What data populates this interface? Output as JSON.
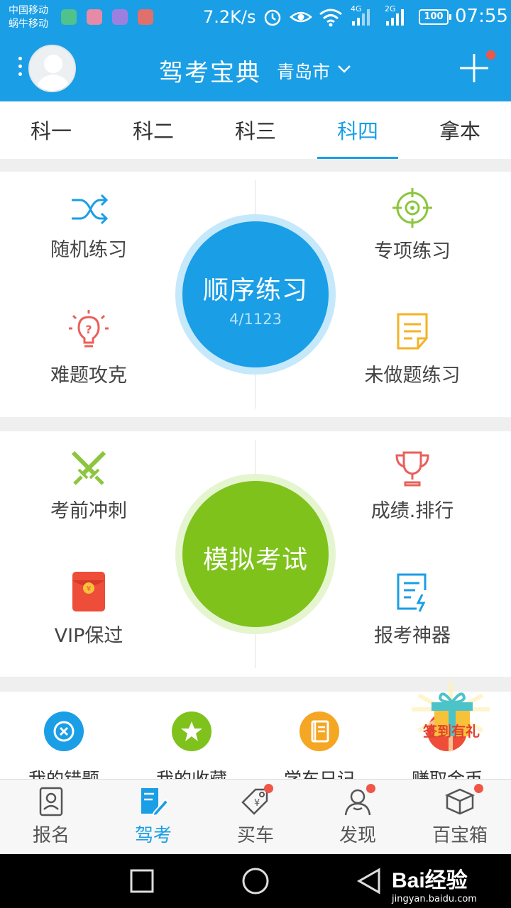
{
  "status_bar": {
    "carrier_1": "中国移动",
    "carrier_2": "蜗牛移动",
    "net_speed": "7.2K/s",
    "net_1": "4G",
    "net_2": "2G",
    "battery": "100",
    "time": "07:55"
  },
  "header": {
    "title": "驾考宝典",
    "city": "青岛市"
  },
  "tabs": [
    {
      "label": "科一"
    },
    {
      "label": "科二"
    },
    {
      "label": "科三"
    },
    {
      "label": "科四",
      "active": true
    },
    {
      "label": "拿本"
    }
  ],
  "practice_panel": {
    "random_label": "随机练习",
    "special_label": "专项练习",
    "hard_label": "难题攻克",
    "undone_label": "未做题练习",
    "center_title": "顺序练习",
    "center_progress": "4/1123"
  },
  "exam_panel": {
    "sprint_label": "考前冲刺",
    "ranking_label": "成绩.排行",
    "vip_label": "VIP保过",
    "tool_label": "报考神器",
    "center_title": "模拟考试"
  },
  "quick_panel": {
    "items": [
      {
        "label": "我的错题"
      },
      {
        "label": "我的收藏"
      },
      {
        "label": "学车日记"
      },
      {
        "label": "赚取金币"
      }
    ],
    "sign_in": "签到有礼"
  },
  "bottom_nav": [
    {
      "label": "报名"
    },
    {
      "label": "驾考",
      "active": true
    },
    {
      "label": "买车"
    },
    {
      "label": "发现"
    },
    {
      "label": "百宝箱"
    }
  ],
  "watermark": {
    "logo": "Bai经验",
    "url": "jingyan.baidu.com"
  },
  "colors": {
    "brand_blue": "#1a9ee6",
    "exam_green": "#7ec21b",
    "badge_red": "#f05646"
  }
}
